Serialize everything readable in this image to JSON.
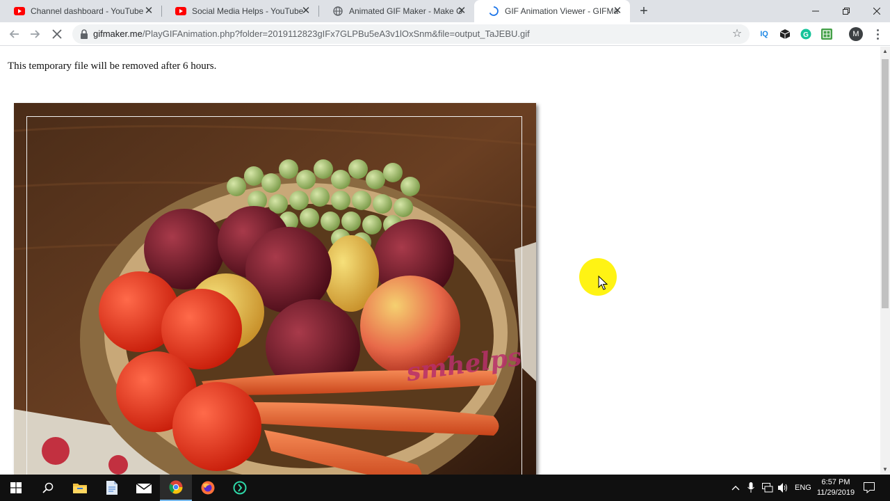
{
  "browser": {
    "tabs": [
      {
        "title": "Channel dashboard - YouTube Studio",
        "icon": "youtube-icon",
        "active": false
      },
      {
        "title": "Social Media Helps - YouTube",
        "icon": "youtube-icon",
        "active": false
      },
      {
        "title": "Animated GIF Maker - Make GIFs",
        "icon": "globe-icon",
        "active": false
      },
      {
        "title": "GIF Animation Viewer - GIFMaker",
        "icon": "loading-spinner-icon",
        "active": true
      }
    ],
    "address": {
      "host": "gifmaker.me",
      "path": "/PlayGIFAnimation.php?folder=2019112823gIFx7GLPBu5eA3v1lOxSnm&file=output_TaJEBU.gif"
    },
    "profile_initial": "M",
    "extensions": [
      "IQ",
      "cube-icon",
      "grammarly-icon",
      "sheet-icon"
    ]
  },
  "page": {
    "notice": "This temporary file will be removed after 6 hours.",
    "gif_watermark": "smhelps"
  },
  "taskbar": {
    "apps": [
      "start-icon",
      "search-icon",
      "file-explorer-icon",
      "document-icon",
      "mail-icon",
      "chrome-icon",
      "firefox-icon",
      "app-icon"
    ],
    "language": "ENG",
    "time": "6:57 PM",
    "date": "11/29/2019"
  },
  "colors": {
    "tabstrip": "#dee1e6",
    "taskbar": "#101010",
    "cursor_highlight": "#fff200"
  }
}
